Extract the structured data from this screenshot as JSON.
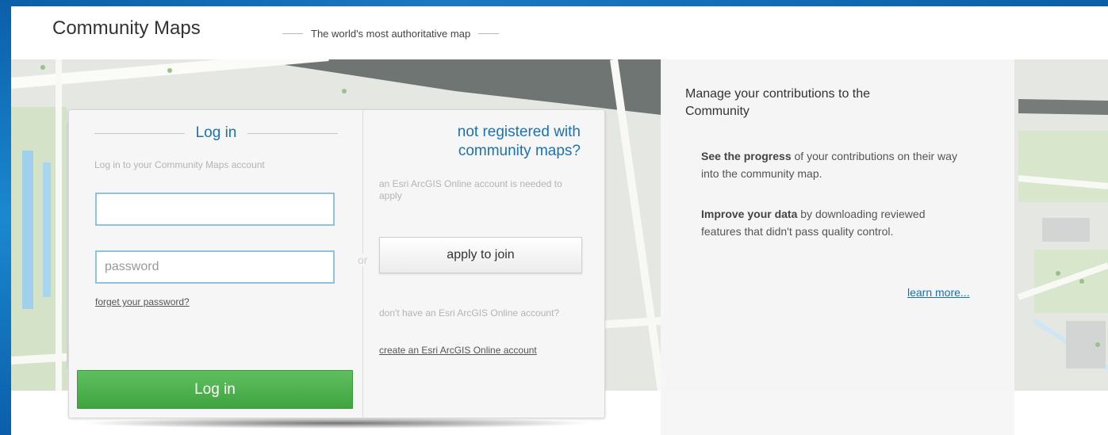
{
  "header": {
    "app_title": "Community Maps",
    "tagline": "The world's most authoritative map"
  },
  "login": {
    "heading": "Log in",
    "subtitle": "Log in to your Community Maps account",
    "username_value": "",
    "password_placeholder": "password",
    "forgot_link": "forget your password?",
    "login_button": "Log in",
    "or_label": "or"
  },
  "register": {
    "heading_line1": "not registered with",
    "heading_line2": "community maps?",
    "requirement_text": "an Esri ArcGIS Online account is needed to apply",
    "apply_button": "apply to join",
    "no_account_text": "don't have an Esri ArcGIS Online account?",
    "create_link": "create an Esri ArcGIS Online account"
  },
  "info": {
    "heading": "Manage your contributions to the Community",
    "p1_bold": "See the progress",
    "p1_rest": " of your contributions on their way into the community map.",
    "p2_bold": "Improve your data",
    "p2_rest": " by downloading reviewed features that didn't pass quality control.",
    "learn_more": "learn more..."
  },
  "colors": {
    "brand_blue": "#1b72b5",
    "frame_blue": "#0b5fa8",
    "login_green": "#4caf50"
  }
}
